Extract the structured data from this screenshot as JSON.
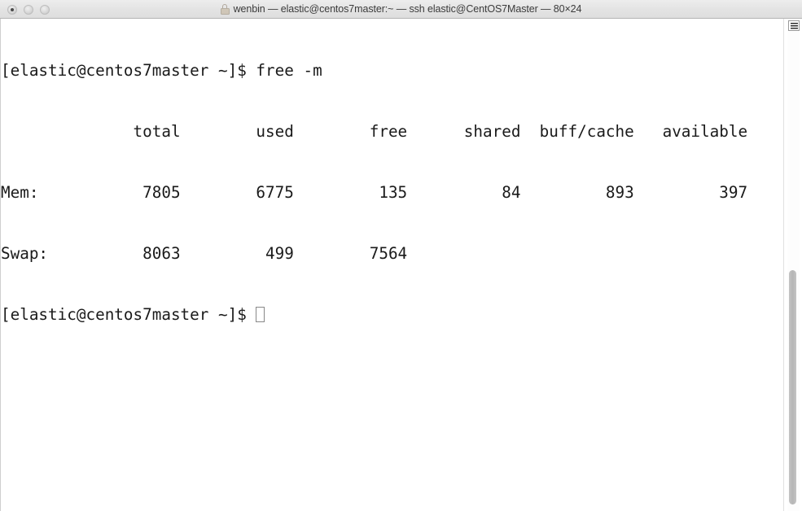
{
  "window": {
    "traffic_lights": [
      {
        "name": "close",
        "label": "Close"
      },
      {
        "name": "minimize",
        "label": "Minimize"
      },
      {
        "name": "zoom",
        "label": "Zoom"
      }
    ],
    "title": "wenbin — elastic@centos7master:~ — ssh elastic@CentOS7Master — 80×24",
    "lock_icon": "lock-icon"
  },
  "terminal": {
    "columns": 80,
    "rows": 24,
    "background": "#ffffff",
    "foreground": "#1a1a1a",
    "prompt": "[elastic@centos7master ~]$",
    "command": "free -m",
    "lines": [
      "[elastic@centos7master ~]$ free -m",
      "              total        used        free      shared  buff/cache   available",
      "Mem:           7805        6775         135          84         893         397",
      "Swap:          8063         499        7564"
    ],
    "prompt_line": "[elastic@centos7master ~]$ ",
    "cursor": "block-outline-cursor"
  },
  "free_output": {
    "headers": [
      "",
      "total",
      "used",
      "free",
      "shared",
      "buff/cache",
      "available"
    ],
    "rows": [
      {
        "label": "Mem:",
        "total": "7805",
        "used": "6775",
        "free": "135",
        "shared": "84",
        "buff_cache": "893",
        "available": "397"
      },
      {
        "label": "Swap:",
        "total": "8063",
        "used": "499",
        "free": "7564",
        "shared": "",
        "buff_cache": "",
        "available": ""
      }
    ]
  },
  "scrollbar": {
    "thumb_name": "scroll-thumb",
    "badge_name": "terminal-badge-icon"
  }
}
